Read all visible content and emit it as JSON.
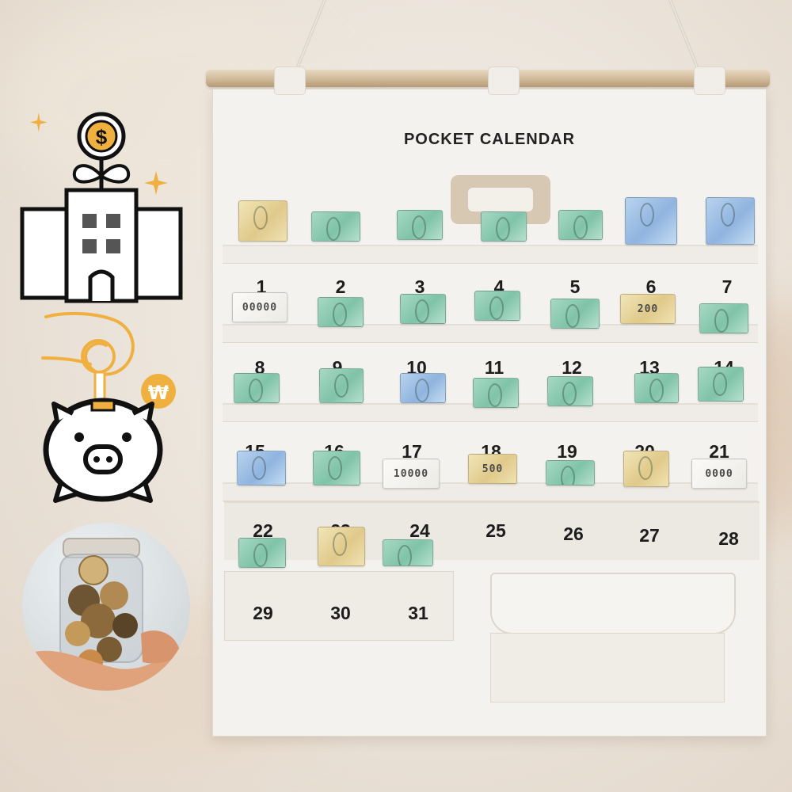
{
  "calendar": {
    "title": "POCKET CALENDAR",
    "days": [
      "1",
      "2",
      "3",
      "4",
      "5",
      "6",
      "7",
      "8",
      "9",
      "10",
      "11",
      "12",
      "13",
      "14",
      "15",
      "16",
      "17",
      "18",
      "19",
      "20",
      "21",
      "22",
      "23",
      "24",
      "25",
      "26",
      "27",
      "28",
      "29",
      "30",
      "31"
    ]
  },
  "bill_labels": {
    "day1": "00000",
    "day6": "200",
    "day17": "10000",
    "day18": "500",
    "day21": "0000"
  },
  "icons": {
    "building": "building-with-coin-plant-icon",
    "piggy": "piggy-bank-with-won-coin-icon",
    "won_symbol": "₩",
    "dollar_symbol": "$"
  },
  "colors": {
    "accent_orange": "#f0b040",
    "outline": "#111111",
    "canvas": "#f4f2ee"
  }
}
